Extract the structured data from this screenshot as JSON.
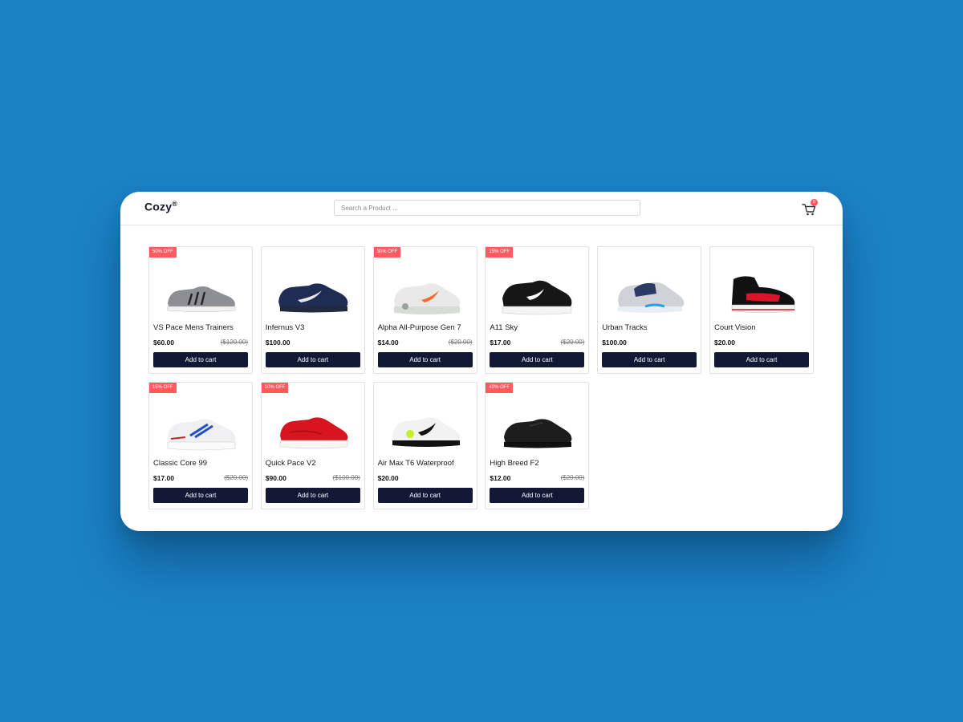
{
  "header": {
    "brand": "Cozy",
    "brand_mark": "®",
    "search_placeholder": "Search a Product ...",
    "cart_count": "0"
  },
  "products": [
    {
      "name": "VS Pace Mens Trainers",
      "price": "$60.00",
      "old_price": "($120.00)",
      "badge": "50% OFF",
      "add_label": "Add to cart",
      "shoe": "grey-trainer"
    },
    {
      "name": "Infernus V3",
      "price": "$100.00",
      "old_price": "",
      "badge": "",
      "add_label": "Add to cart",
      "shoe": "navy-runner"
    },
    {
      "name": "Alpha All-Purpose Gen 7",
      "price": "$14.00",
      "old_price": "($20.00)",
      "badge": "30% OFF",
      "add_label": "Add to cart",
      "shoe": "white-orange"
    },
    {
      "name": "A11 Sky",
      "price": "$17.00",
      "old_price": "($20.00)",
      "badge": "15% OFF",
      "add_label": "Add to cart",
      "shoe": "black-air"
    },
    {
      "name": "Urban Tracks",
      "price": "$100.00",
      "old_price": "",
      "badge": "",
      "add_label": "Add to cart",
      "shoe": "grey-blue"
    },
    {
      "name": "Court Vision",
      "price": "$20.00",
      "old_price": "",
      "badge": "",
      "add_label": "Add to cart",
      "shoe": "black-red"
    },
    {
      "name": "Classic Core 99",
      "price": "$17.00",
      "old_price": "($20.00)",
      "badge": "15% OFF",
      "add_label": "Add to cart",
      "shoe": "white-blue"
    },
    {
      "name": "Quick Pace V2",
      "price": "$90.00",
      "old_price": "($100.00)",
      "badge": "10% OFF",
      "add_label": "Add to cart",
      "shoe": "red-runner"
    },
    {
      "name": "Air Max T6 Waterproof",
      "price": "$20.00",
      "old_price": "",
      "badge": "",
      "add_label": "Add to cart",
      "shoe": "white-volt"
    },
    {
      "name": "High Breed F2",
      "price": "$12.00",
      "old_price": "($20.00)",
      "badge": "40% OFF",
      "add_label": "Add to cart",
      "shoe": "black-leather"
    }
  ],
  "colors": {
    "background": "#1b82c6",
    "accent": "#ff5a5f",
    "button": "#141837"
  }
}
